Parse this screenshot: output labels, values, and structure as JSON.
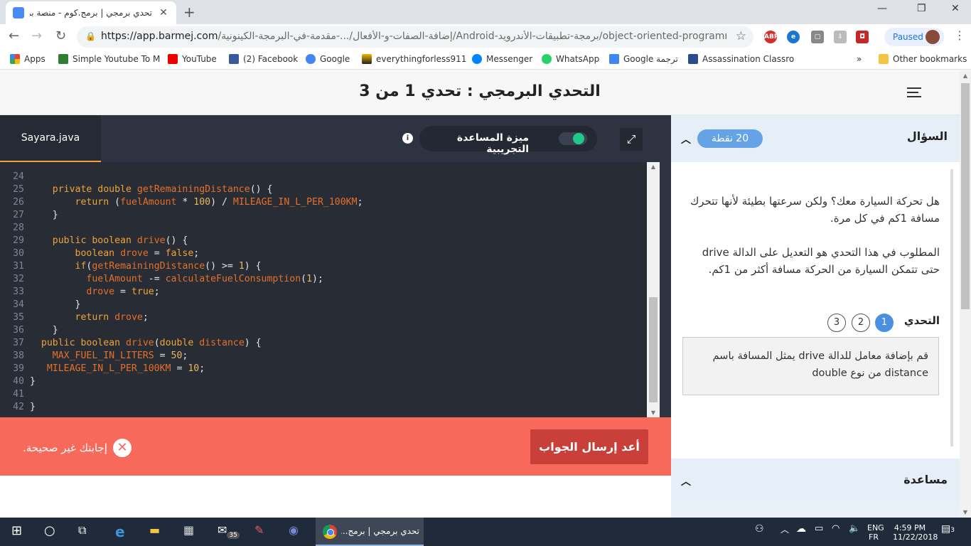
{
  "browser": {
    "tab_title": "تحدي برمجي | برمج.كوم - منصة برمـ",
    "url_host": "https://app.barmej.com",
    "url_path": "/إضافة-الصفات-و-الأفعال/...-مقدمة-في-البرمجة-الكينونية/Android-برمجة-تطبيقات-الأندرويد/object-oriented-programming",
    "profile_status": "Paused",
    "bookmarks": [
      {
        "label": "Apps",
        "color": "#ea4335"
      },
      {
        "label": "Simple Youtube To M",
        "color": "#2e7d32"
      },
      {
        "label": "YouTube",
        "color": "#e00"
      },
      {
        "label": "(2) Facebook",
        "color": "#3b5998"
      },
      {
        "label": "Google",
        "color": "#4285f4"
      },
      {
        "label": "everythingforless911",
        "color": "#222"
      },
      {
        "label": "Messenger",
        "color": "#0084ff"
      },
      {
        "label": "WhatsApp",
        "color": "#25d366"
      },
      {
        "label": "Google ترجمة",
        "color": "#4285f4"
      },
      {
        "label": "Assassination Classro",
        "color": "#2a4b8d"
      }
    ],
    "other_bookmarks": "Other bookmarks",
    "more_bookmarks": "»"
  },
  "header": {
    "title": "التحدي البرمجي : تحدي 1 من 3"
  },
  "editor": {
    "file_tab": "Sayara.java",
    "assist_label": "ميزة المساعدة التجريبية",
    "info_glyph": "i",
    "expand_glyph": "⤢",
    "lines": [
      {
        "n": "24",
        "t": ""
      },
      {
        "n": "25",
        "t": "    private double getRemainingDistance() {"
      },
      {
        "n": "26",
        "t": "        return (fuelAmount * 100) / MILEAGE_IN_L_PER_100KM;"
      },
      {
        "n": "27",
        "t": "    }"
      },
      {
        "n": "28",
        "t": ""
      },
      {
        "n": "29",
        "t": "    public boolean drive() {"
      },
      {
        "n": "30",
        "t": "        boolean drove = false;"
      },
      {
        "n": "31",
        "t": "        if(getRemainingDistance() >= 1) {"
      },
      {
        "n": "32",
        "t": "          fuelAmount -= calculateFuelConsumption(1);"
      },
      {
        "n": "33",
        "t": "          drove = true;"
      },
      {
        "n": "34",
        "t": "        }"
      },
      {
        "n": "35",
        "t": "        return drove;"
      },
      {
        "n": "36",
        "t": "    }"
      },
      {
        "n": "37",
        "t": "  public boolean drive(double distance) {"
      },
      {
        "n": "38",
        "t": "    MAX_FUEL_IN_LITERS = 50;"
      },
      {
        "n": "39",
        "t": "   MILEAGE_IN_L_PER_100KM = 10;"
      },
      {
        "n": "40",
        "t": "}"
      },
      {
        "n": "41",
        "t": ""
      },
      {
        "n": "42",
        "t": "}"
      }
    ]
  },
  "feedback": {
    "resubmit_label": "أعد إرسال الجواب",
    "wrong_message": "إجابتك غير صحيحة.",
    "wrong_glyph": "✕"
  },
  "question": {
    "title": "السؤال",
    "points": "20 نقطة",
    "paragraph_1": "هل تحركة السيارة معك؟ ولكن سرعتها بطيئة لأنها تتحرك مسافة 1كم في كل مرة.",
    "paragraph_2": "المطلوب في هذا التحدي هو التعديل على الدالة drive حتى تتمكن السيارة من الحركة مسافة أكثر من 1كم.",
    "challenge_label": "التحدي",
    "challenge_steps": [
      "1",
      "2",
      "3"
    ],
    "task_text": "قم بإضافة معامل للدالة drive يمثل المسافة باسم distance من نوع double"
  },
  "help": {
    "title": "مساعدة"
  },
  "taskbar": {
    "chrome_task": "تحدي برمجي | برمج...",
    "mail_badge": "35",
    "lang_1": "ENG",
    "lang_2": "FR",
    "time": "4:59 PM",
    "date": "11/22/2018",
    "notif_count": "3"
  }
}
